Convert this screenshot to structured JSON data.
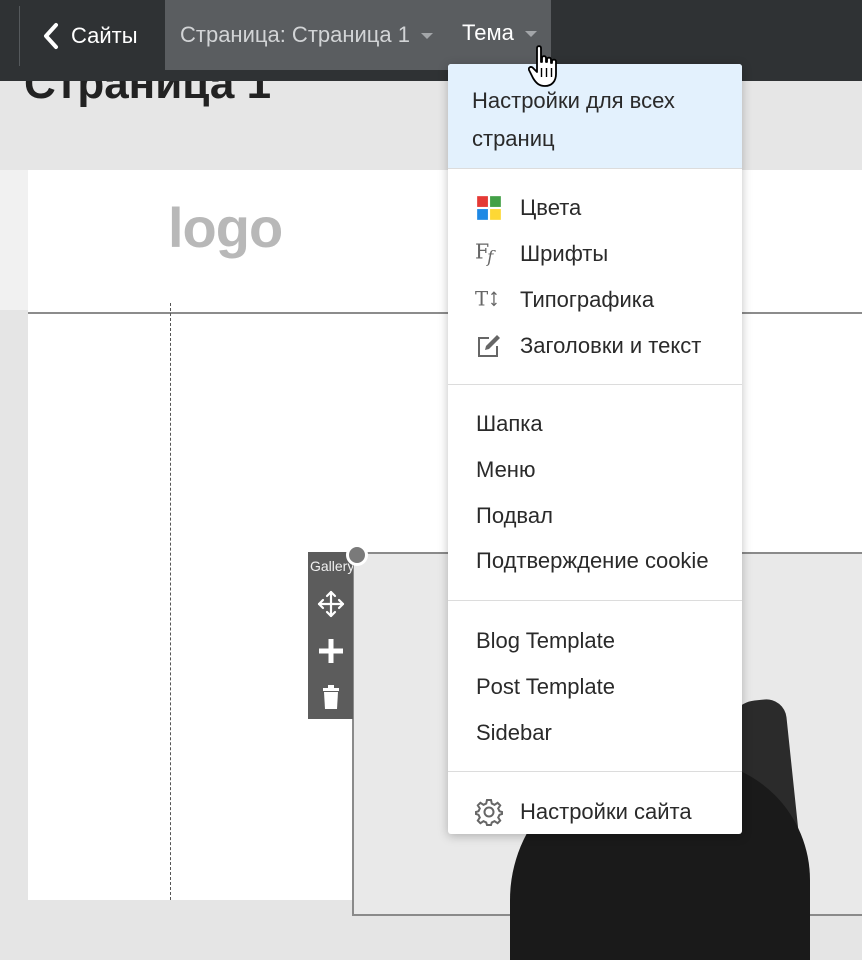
{
  "topbar": {
    "back_label": "Сайты",
    "page_label": "Страница: Страница 1",
    "theme_label": "Тема"
  },
  "page": {
    "title": "Страница 1"
  },
  "canvas": {
    "logo_text": "logo",
    "gallery_label": "Gallery"
  },
  "menu": {
    "all_pages_settings": "Настройки для всех страниц",
    "colors": "Цвета",
    "fonts": "Шрифты",
    "typography": "Типографика",
    "headings_text": "Заголовки и текст",
    "header": "Шапка",
    "menu": "Меню",
    "footer": "Подвал",
    "cookie": "Подтверждение cookie",
    "blog_template": "Blog Template",
    "post_template": "Post Template",
    "sidebar": "Sidebar",
    "site_settings": "Настройки сайта"
  },
  "icons": {
    "colors": "colors-grid-icon",
    "fonts": "fonts-ff-icon",
    "typography": "typography-icon",
    "headings": "edit-text-icon",
    "settings": "gear-icon"
  },
  "colors": {
    "topbar_bg": "#2f3234",
    "active_bg": "#5a5d60",
    "menu_highlight": "#e3f1fd",
    "swatch_red": "#e53935",
    "swatch_green": "#43a047",
    "swatch_blue": "#1e88e5",
    "swatch_yellow": "#fdd835"
  }
}
